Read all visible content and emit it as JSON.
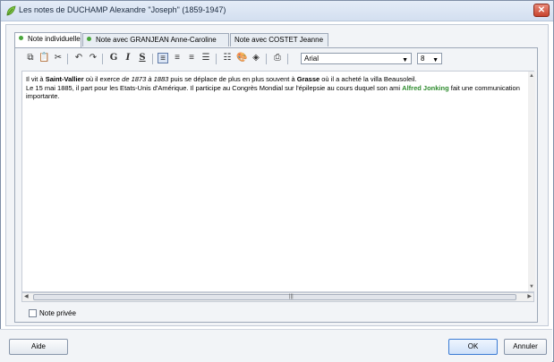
{
  "window": {
    "title": "Les notes de DUCHAMP Alexandre \"Joseph\" (1859-1947)",
    "close_label": "✕"
  },
  "tabs": [
    {
      "label": "Note individuelle",
      "has_dot": true,
      "active": true
    },
    {
      "label": "Note avec GRANJEAN Anne-Caroline",
      "has_dot": true,
      "active": false
    },
    {
      "label": "Note avec COSTET Jeanne",
      "has_dot": false,
      "active": false
    }
  ],
  "toolbar": {
    "icons": [
      "copy-icon",
      "paste-icon",
      "cut-icon",
      "undo-icon",
      "redo-icon",
      "bold-icon",
      "italic-icon",
      "underline-icon",
      "align-left-icon",
      "align-center-icon",
      "align-right-icon",
      "justify-icon",
      "list-icon",
      "text-color-icon",
      "highlight-icon",
      "print-icon"
    ],
    "bold_label": "G",
    "italic_label": "I",
    "underline_label": "S",
    "font": "Arial",
    "size": "8"
  },
  "editor": {
    "line1": {
      "a": "Il vit  à ",
      "b": "Saint-Vallier",
      "c": " où il exerce  ",
      "d": "de 1873 à 1883",
      "e": " puis se déplace de plus en plus  souvent à ",
      "f": "Grasse",
      "g": " où il a acheté la villa Beausoleil."
    },
    "line2": {
      "a": "Le 15 mai 1885, il  part pour les Etats-Unis d'Amérique. Il participe au Congrès Mondial sur l'épilepsie au cours duquel son ami ",
      "b": "Alfred Jonking",
      "c": " fait une communication importante."
    }
  },
  "private_note": {
    "label": "Note privée",
    "checked": false
  },
  "buttons": {
    "help": "Aide",
    "ok": "OK",
    "cancel": "Annuler"
  },
  "colors": {
    "accent": "#3b7bd4",
    "highlight_text": "#2e8b2e",
    "close": "#c7442e"
  }
}
